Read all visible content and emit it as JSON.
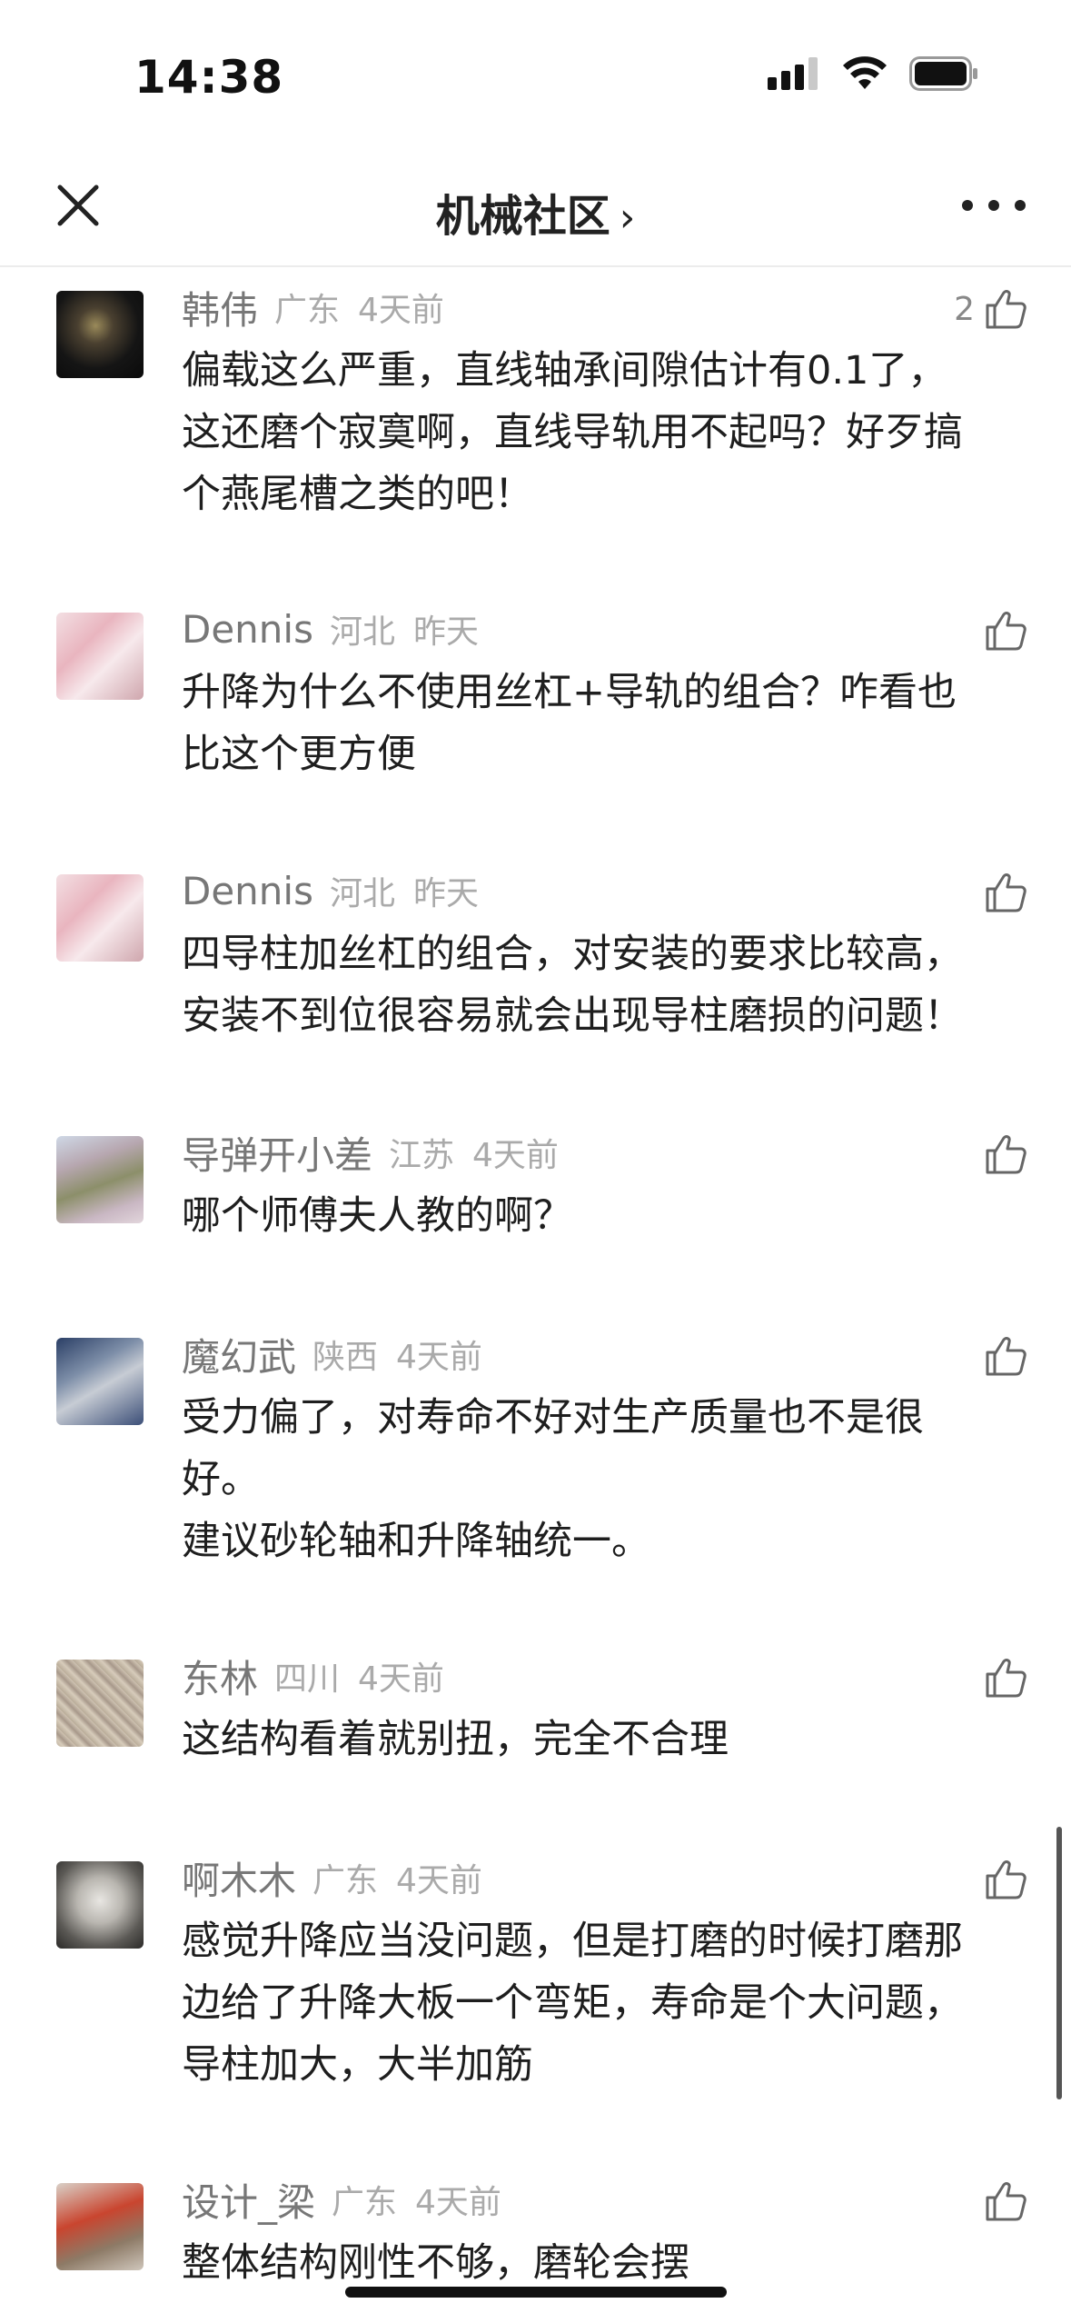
{
  "status_bar": {
    "time": "14:38"
  },
  "nav": {
    "title": "机械社区",
    "chevron": "›"
  },
  "comments": [
    {
      "name": "韩伟",
      "location": "广东",
      "time": "4天前",
      "likes": "2",
      "text": "偏载这么严重，直线轴承间隙估计有0.1了，\n这还磨个寂寞啊，直线导轨用不起吗？好歹搞\n个燕尾槽之类的吧！"
    },
    {
      "name": "Dennis",
      "location": "河北",
      "time": "昨天",
      "likes": "",
      "text": "升降为什么不使用丝杠+导轨的组合？咋看也\n比这个更方便"
    },
    {
      "name": "Dennis",
      "location": "河北",
      "time": "昨天",
      "likes": "",
      "text": "四导柱加丝杠的组合，对安装的要求比较高，\n安装不到位很容易就会出现导柱磨损的问题！"
    },
    {
      "name": "导弹开小差",
      "location": "江苏",
      "time": "4天前",
      "likes": "",
      "text": "哪个师傅夫人教的啊？"
    },
    {
      "name": "魔幻武",
      "location": "陕西",
      "time": "4天前",
      "likes": "",
      "text": "受力偏了，对寿命不好对生产质量也不是很\n好。\n建议砂轮轴和升降轴统一。"
    },
    {
      "name": "东林",
      "location": "四川",
      "time": "4天前",
      "likes": "",
      "text": "这结构看着就别扭，完全不合理"
    },
    {
      "name": "啊木木",
      "location": "广东",
      "time": "4天前",
      "likes": "",
      "text": "感觉升降应当没问题，但是打磨的时候打磨那\n边给了升降大板一个弯矩，寿命是个大问题，\n导柱加大，大半加筋"
    },
    {
      "name": "设计_梁",
      "location": "广东",
      "time": "4天前",
      "likes": "",
      "text": "整体结构刚性不够，磨轮会摆"
    }
  ],
  "icons": {
    "close": "close-icon",
    "more": "more-icon",
    "like": "thumbs-up-icon",
    "signal": "signal-icon",
    "wifi": "wifi-icon",
    "battery": "battery-icon"
  }
}
